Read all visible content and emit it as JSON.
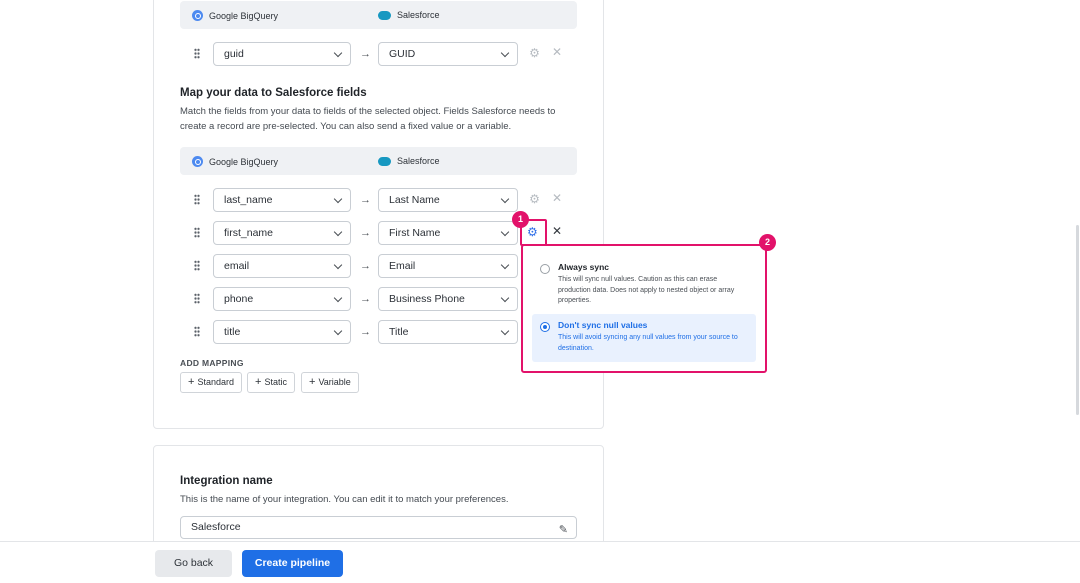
{
  "id_mapping": {
    "header": {
      "source": "Google BigQuery",
      "destination": "Salesforce"
    },
    "row": {
      "source_field": "guid",
      "destination_field": "GUID"
    }
  },
  "map_section": {
    "title": "Map your data to Salesforce fields",
    "description": "Match the fields from your data to fields of the selected object. Fields Salesforce needs to create a record are pre-selected. You can also send a fixed value or a variable.",
    "header": {
      "source": "Google BigQuery",
      "destination": "Salesforce"
    },
    "rows": [
      {
        "source_field": "last_name",
        "destination_field": "Last Name"
      },
      {
        "source_field": "first_name",
        "destination_field": "First Name"
      },
      {
        "source_field": "email",
        "destination_field": "Email"
      },
      {
        "source_field": "phone",
        "destination_field": "Business Phone"
      },
      {
        "source_field": "title",
        "destination_field": "Title"
      }
    ],
    "add_mapping_label": "ADD MAPPING",
    "add_buttons": [
      "Standard",
      "Static",
      "Variable"
    ]
  },
  "popover": {
    "options": [
      {
        "title": "Always sync",
        "description": "This will sync null values. Caution as this can erase production data. Does not apply to nested object or array properties.",
        "selected": false
      },
      {
        "title": "Don't sync null values",
        "description": "This will avoid syncing any null values from your source to destination.",
        "selected": true
      }
    ]
  },
  "badges": [
    "1",
    "2"
  ],
  "integration": {
    "title": "Integration name",
    "description": "This is the name of your integration. You can edit it to match your preferences.",
    "value": "Salesforce"
  },
  "footer": {
    "back_label": "Go back",
    "create_label": "Create pipeline"
  },
  "colors": {
    "accent": "#1f6fe6",
    "highlight": "#e2126a"
  }
}
